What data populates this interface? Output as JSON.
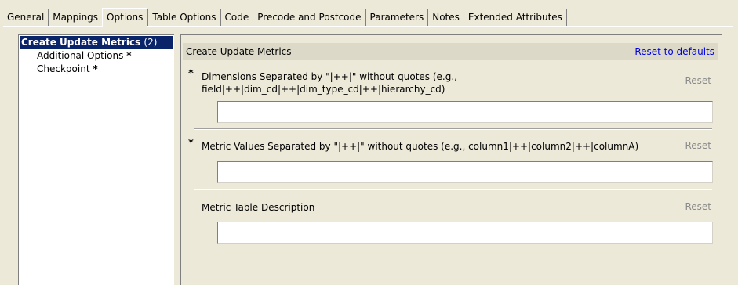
{
  "tabs": [
    {
      "label": "General"
    },
    {
      "label": "Mappings"
    },
    {
      "label": "Options"
    },
    {
      "label": "Table Options"
    },
    {
      "label": "Code"
    },
    {
      "label": "Precode and Postcode"
    },
    {
      "label": "Parameters"
    },
    {
      "label": "Notes"
    },
    {
      "label": "Extended Attributes"
    }
  ],
  "active_tab": "Options",
  "tree": {
    "root": {
      "label": "Create Update Metrics",
      "count": "(2)"
    },
    "children": [
      {
        "label": "Additional Options",
        "marker": "*"
      },
      {
        "label": "Checkpoint",
        "marker": "*"
      }
    ]
  },
  "form": {
    "title": "Create Update Metrics",
    "reset_defaults": "Reset to defaults",
    "fields": [
      {
        "required_marker": "*",
        "label_line1": "Dimensions Separated by \"|++|\" without quotes (e.g.,",
        "label_line2": "field|++|dim_cd|++|dim_type_cd|++|hierarchy_cd)",
        "reset": "Reset",
        "value": ""
      },
      {
        "required_marker": "*",
        "label_line1": "Metric Values Separated by \"|++|\" without quotes (e.g., column1|++|column2|++|columnA)",
        "label_line2": "",
        "reset": "Reset",
        "value": ""
      },
      {
        "required_marker": "",
        "label_line1": "Metric Table Description",
        "label_line2": "",
        "reset": "Reset",
        "value": ""
      }
    ]
  }
}
